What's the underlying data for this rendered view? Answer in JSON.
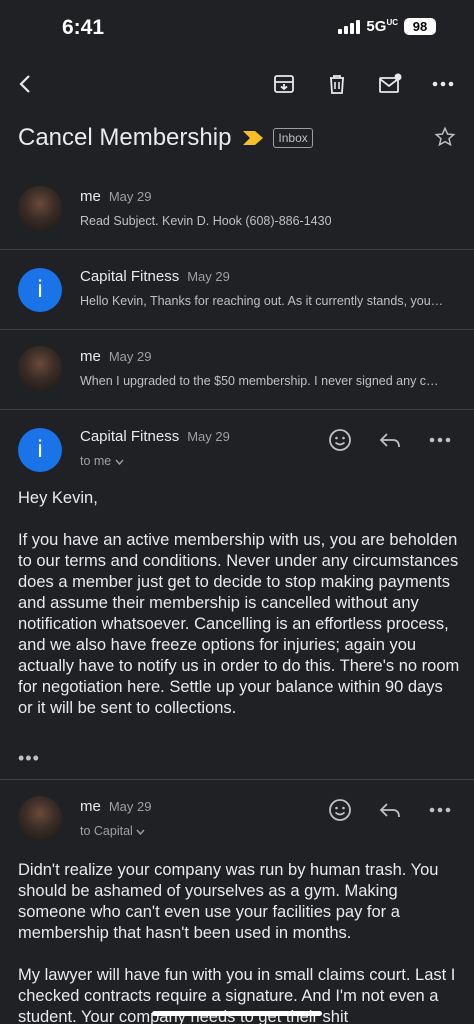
{
  "status": {
    "time": "6:41",
    "network": "5G",
    "network_suffix": "UC",
    "battery": "98"
  },
  "email": {
    "subject": "Cancel Membership",
    "label": "Inbox"
  },
  "messages": [
    {
      "sender": "me",
      "date": "May 29",
      "snippet": "Read Subject. Kevin D. Hook (608)-886-1430"
    },
    {
      "sender": "Capital Fitness",
      "date": "May 29",
      "snippet": "Hello Kevin, Thanks for reaching out. As it currently stands, you are not within the terms of cancellation."
    },
    {
      "sender": "me",
      "date": "May 29",
      "snippet": "When I upgraded to the $50 membership. I never signed any contract agreeing to terms."
    },
    {
      "sender": "Capital Fitness",
      "date": "May 29",
      "to": "to me",
      "greeting": "Hey Kevin,",
      "body": "If you have an active membership with us, you are beholden to our terms and conditions. Never under any circumstances does a member just get to decide to stop making payments and assume their membership is cancelled without any notification whatsoever. Cancelling is an effortless process, and we also have freeze options for injuries; again you actually have to notify us in order to do this. There's no room for negotiation here. Settle up your balance within 90 days or it will be sent to collections."
    },
    {
      "sender": "me",
      "date": "May 29",
      "to": "to Capital",
      "body1": "Didn't realize your company was run by human trash. You should be ashamed of yourselves as a gym. Making someone who can't even use your facilities pay for a membership that hasn't been used in months.",
      "body2": "My lawyer will have fun with you in small claims court. Last I checked contracts require a signature. And I'm not even a student. Your company needs to get their shit"
    }
  ],
  "more_dots": "•••",
  "avatar_letter": "i"
}
